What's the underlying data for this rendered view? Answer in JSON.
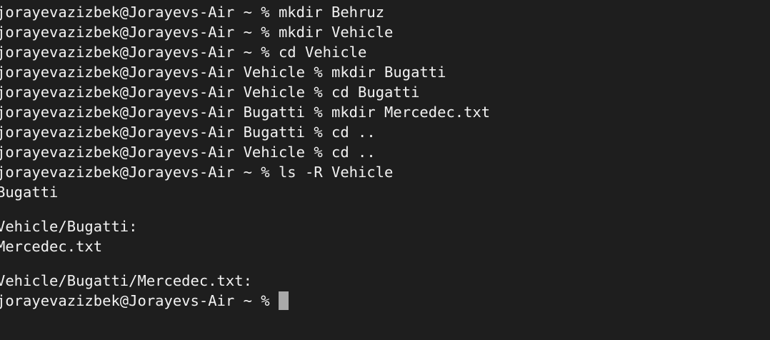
{
  "terminal": {
    "lines": [
      "jorayevazizbek@Jorayevs-Air ~ % mkdir Behruz",
      "jorayevazizbek@Jorayevs-Air ~ % mkdir Vehicle",
      "jorayevazizbek@Jorayevs-Air ~ % cd Vehicle",
      "jorayevazizbek@Jorayevs-Air Vehicle % mkdir Bugatti",
      "jorayevazizbek@Jorayevs-Air Vehicle % cd Bugatti",
      "jorayevazizbek@Jorayevs-Air Bugatti % mkdir Mercedec.txt",
      "jorayevazizbek@Jorayevs-Air Bugatti % cd ..",
      "jorayevazizbek@Jorayevs-Air Vehicle % cd ..",
      "jorayevazizbek@Jorayevs-Air ~ % ls -R Vehicle",
      "Bugatti",
      "",
      "Vehicle/Bugatti:",
      "Mercedec.txt",
      "",
      "Vehicle/Bugatti/Mercedec.txt:"
    ],
    "prompt": "jorayevazizbek@Jorayevs-Air ~ %",
    "colors": {
      "background": "#1e1e1e",
      "text": "#f2f2f2",
      "cursor": "#a9a9a9"
    }
  }
}
